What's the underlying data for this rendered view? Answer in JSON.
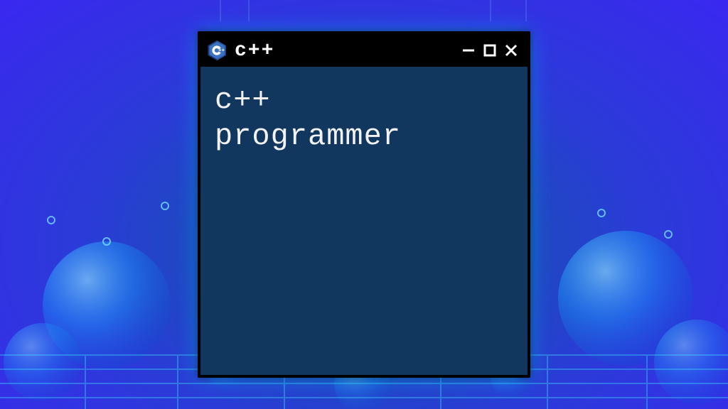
{
  "window": {
    "title": "c++",
    "icon": "cpp-logo",
    "controls": {
      "minimize": "–",
      "maximize": "□",
      "close": "×"
    },
    "content_text": "c++\nprogrammer"
  },
  "colors": {
    "window_bg": "#12375e",
    "titlebar_bg": "#000000",
    "text": "#f2f2f2"
  }
}
